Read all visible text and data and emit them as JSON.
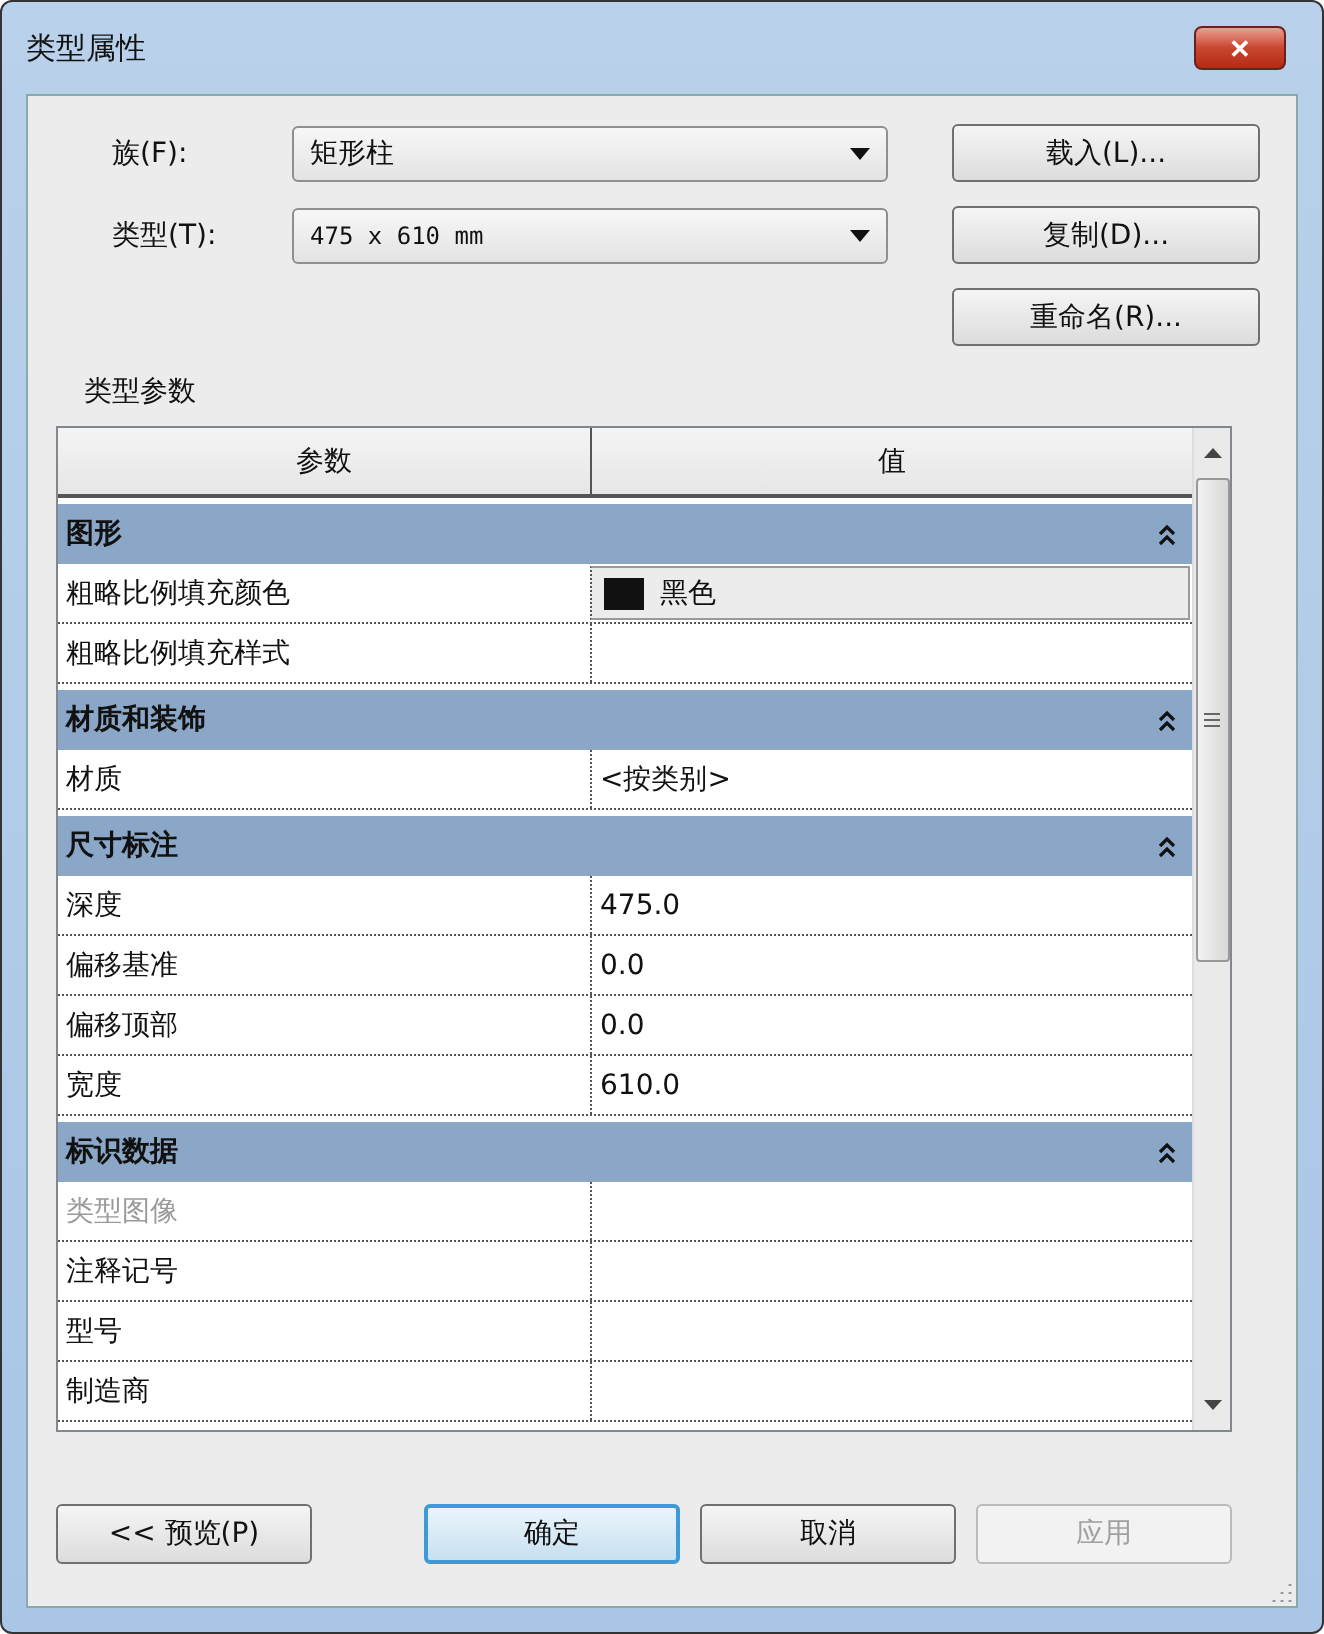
{
  "window": {
    "title": "类型属性",
    "close": "✕"
  },
  "family": {
    "label": "族(F):",
    "value": "矩形柱"
  },
  "type": {
    "label": "类型(T):",
    "value": "475 x 610 mm"
  },
  "side_buttons": [
    "载入(L)...",
    "复制(D)...",
    "重命名(R)..."
  ],
  "section_title": "类型参数",
  "table": {
    "columns": [
      "参数",
      "值"
    ],
    "groups": [
      {
        "name": "图形",
        "expanded": true,
        "rows": [
          {
            "name": "粗略比例填充颜色",
            "kind": "color",
            "value": "黑色",
            "color": "#111111",
            "disabled": false
          },
          {
            "name": "粗略比例填充样式",
            "kind": "text",
            "disabled": false
          }
        ]
      },
      {
        "name": "材质和装饰",
        "expanded": true,
        "rows": [
          {
            "name": "材质",
            "kind": "text",
            "value": "<按类别>",
            "disabled": false
          }
        ]
      },
      {
        "name": "尺寸标注",
        "expanded": true,
        "rows": [
          {
            "name": "深度",
            "kind": "text",
            "value": "475.0",
            "disabled": false
          },
          {
            "name": "偏移基准",
            "kind": "text",
            "value": "0.0",
            "disabled": false
          },
          {
            "name": "偏移顶部",
            "kind": "text",
            "value": "0.0",
            "disabled": false
          },
          {
            "name": "宽度",
            "kind": "text",
            "value": "610.0",
            "disabled": false
          }
        ]
      },
      {
        "name": "标识数据",
        "expanded": true,
        "rows": [
          {
            "name": "类型图像",
            "kind": "text",
            "disabled": true
          },
          {
            "name": "注释记号",
            "kind": "text",
            "disabled": false
          },
          {
            "name": "型号",
            "kind": "text",
            "disabled": false
          },
          {
            "name": "制造商",
            "kind": "text",
            "disabled": false
          }
        ]
      }
    ]
  },
  "buttons": [
    {
      "label": "<< 预览(P)",
      "default": false,
      "disabled": false
    },
    {
      "label": "确定",
      "default": true,
      "disabled": false
    },
    {
      "label": "取消",
      "default": false,
      "disabled": false
    },
    {
      "label": "应用",
      "default": false,
      "disabled": true
    }
  ]
}
